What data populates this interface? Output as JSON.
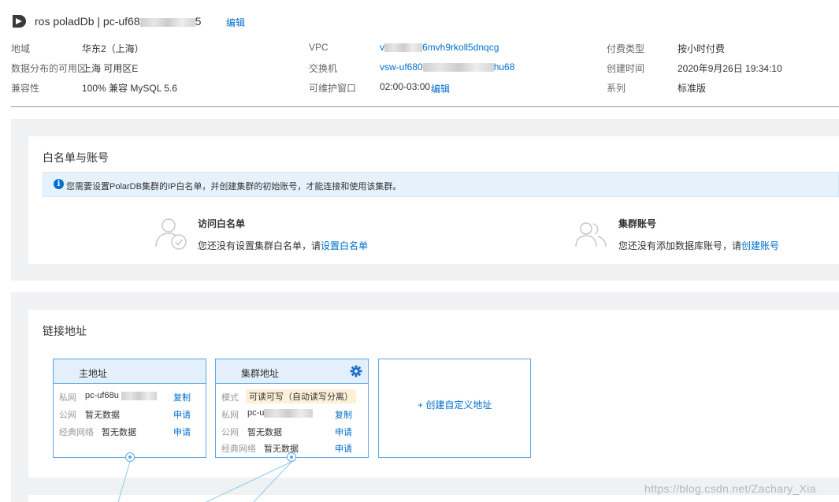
{
  "header": {
    "title": "ros poladDb | pc-uf68",
    "title_suffix": "5",
    "edit": "编辑"
  },
  "info": {
    "region_label": "地域",
    "region_value": "华东2（上海）",
    "zone_label": "数据分布的可用区",
    "zone_value": "上海 可用区E",
    "compat_label": "兼容性",
    "compat_value": "100% 兼容 MySQL 5.6",
    "vpc_label": "VPC",
    "vpc_value_prefix": "v",
    "vpc_value": "6mvh9rkoll5dnqcg",
    "switch_label": "交换机",
    "switch_value": "vsw-uf680",
    "switch_value_tail": "hu68",
    "maint_label": "可维护窗口",
    "maint_value": "02:00-03:00",
    "maint_edit": "编辑",
    "billing_label": "付费类型",
    "billing_value": "按小时付费",
    "created_label": "创建时间",
    "created_value": "2020年9月26日 19:34:10",
    "series_label": "系列",
    "series_value": "标准版"
  },
  "whitelist_section": {
    "title": "白名单与账号",
    "notice": "您需要设置PolarDB集群的IP白名单，并创建集群的初始账号，才能连接和使用该集群。",
    "whitelist": {
      "title": "访问白名单",
      "desc_prefix": "您还没有设置集群白名单，请",
      "link": "设置白名单"
    },
    "account": {
      "title": "集群账号",
      "desc_prefix": "您还没有添加数据库账号，请",
      "link": "创建账号"
    }
  },
  "address_section": {
    "title": "链接地址",
    "main": {
      "title": "主地址",
      "rows": [
        {
          "label": "私网",
          "value": "pc-uf68u",
          "action": "复制"
        },
        {
          "label": "公网",
          "value": "暂无数据",
          "action": "申请"
        },
        {
          "label": "经典网络",
          "value": "暂无数据",
          "action": "申请"
        }
      ]
    },
    "cluster": {
      "title": "集群地址",
      "mode_label": "模式",
      "mode_value": "可读可写（自动读写分离）",
      "rows": [
        {
          "label": "私网",
          "value": "pc-u",
          "action": "复制"
        },
        {
          "label": "公网",
          "value": "暂无数据",
          "action": "申请"
        },
        {
          "label": "经典网络",
          "value": "暂无数据",
          "action": "申请"
        }
      ]
    },
    "custom": {
      "label": "+ 创建自定义地址"
    }
  },
  "watermark": "https://blog.csdn.net/Zachary_Xia",
  "colors": {
    "link": "#0070cc",
    "section_bg": "#eff1f2",
    "card_border": "#5aa7e6",
    "card_head": "#e3effa",
    "notice_bg": "#e6f2fb",
    "mode_badge": "#fdf0d7"
  },
  "icons": [
    "logo-icon",
    "info-icon",
    "user-check-icon",
    "users-icon",
    "gear-icon",
    "plus-icon"
  ]
}
